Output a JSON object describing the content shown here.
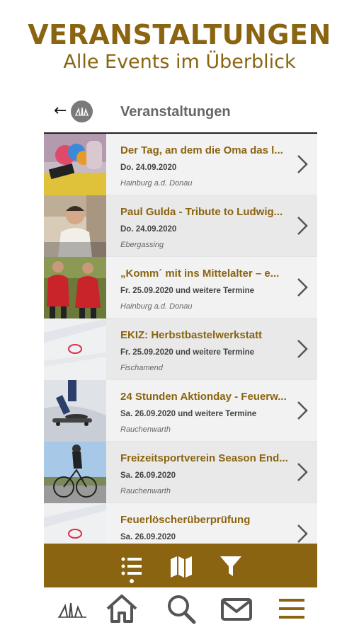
{
  "hero": {
    "title": "VERANSTALTUNGEN",
    "subtitle": "Alle Events im Überblick"
  },
  "appbar": {
    "back_glyph": "←",
    "title": "Veranstaltungen"
  },
  "events": [
    {
      "title": "Der Tag, an dem die Oma das l...",
      "date": "Do. 24.09.2020",
      "place": "Hainburg a.d. Donau",
      "thumb": "toy-icon"
    },
    {
      "title": "Paul Gulda - Tribute to Ludwig...",
      "date": "Do. 24.09.2020",
      "place": "Ebergassing",
      "thumb": "portrait-photo"
    },
    {
      "title": "„Komm´ mit ins Mittelalter – e...",
      "date": "Fr. 25.09.2020 und weitere Termine",
      "place": "Hainburg a.d. Donau",
      "thumb": "costume-photo"
    },
    {
      "title": "EKIZ: Herbstbastelwerkstatt",
      "date": "Fr. 25.09.2020 und weitere Termine",
      "place": "Fischamend",
      "thumb": "craft-photo"
    },
    {
      "title": "24 Stunden Aktionday - Feuerw...",
      "date": "Sa. 26.09.2020 und weitere Termine",
      "place": "Rauchenwarth",
      "thumb": "skate-photo"
    },
    {
      "title": "Freizeitsportverein Season End...",
      "date": "Sa. 26.09.2020",
      "place": "Rauchenwarth",
      "thumb": "cyclist-photo"
    },
    {
      "title": "Feuerlöscherüberprüfung",
      "date": "Sa. 26.09.2020",
      "place": "",
      "thumb": "craft-photo"
    }
  ],
  "toolbar": {
    "icons": [
      "list-icon",
      "map-icon",
      "filter-icon"
    ],
    "active": "list-icon"
  },
  "bottom_nav": {
    "icons": [
      "logo-icon",
      "home-icon",
      "search-icon",
      "mail-icon",
      "menu-icon"
    ]
  },
  "colors": {
    "brand": "#8a6410",
    "chevron": "#555555",
    "nav_icon": "#555555"
  }
}
